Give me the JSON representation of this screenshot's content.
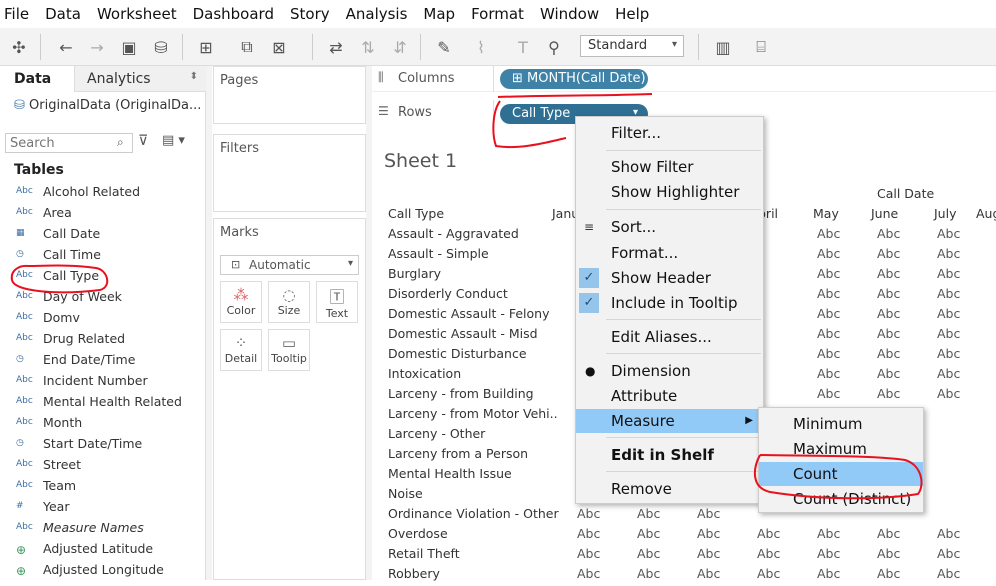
{
  "menubar": [
    "File",
    "Data",
    "Worksheet",
    "Dashboard",
    "Story",
    "Analysis",
    "Map",
    "Format",
    "Window",
    "Help"
  ],
  "toolbar": {
    "mark_type": "Standard"
  },
  "left": {
    "tab_data": "Data",
    "tab_analytics": "Analytics",
    "datasource": "OriginalData (OriginalDa...",
    "search_placeholder": "Search",
    "tables_heading": "Tables",
    "fields": [
      {
        "icon": "Abc",
        "name": "Alcohol Related"
      },
      {
        "icon": "Abc",
        "name": "Area"
      },
      {
        "icon": "date",
        "name": "Call Date"
      },
      {
        "icon": "datetime",
        "name": "Call Time"
      },
      {
        "icon": "Abc",
        "name": "Call Type"
      },
      {
        "icon": "Abc",
        "name": "Day of Week"
      },
      {
        "icon": "Abc",
        "name": "Domv"
      },
      {
        "icon": "Abc",
        "name": "Drug Related"
      },
      {
        "icon": "datetime",
        "name": "End Date/Time"
      },
      {
        "icon": "Abc",
        "name": "Incident Number"
      },
      {
        "icon": "Abc",
        "name": "Mental Health Related"
      },
      {
        "icon": "Abc",
        "name": "Month"
      },
      {
        "icon": "datetime",
        "name": "Start Date/Time"
      },
      {
        "icon": "Abc",
        "name": "Street"
      },
      {
        "icon": "Abc",
        "name": "Team"
      },
      {
        "icon": "#",
        "name": "Year"
      },
      {
        "icon": "Abc",
        "name": "Measure Names"
      },
      {
        "icon": "globe",
        "name": "Adjusted Latitude"
      },
      {
        "icon": "globe",
        "name": "Adjusted Longitude"
      }
    ]
  },
  "cards": {
    "pages": "Pages",
    "filters": "Filters",
    "marks": "Marks",
    "marks_type": "Automatic",
    "buttons": [
      "Color",
      "Size",
      "Text",
      "Detail",
      "Tooltip"
    ]
  },
  "shelves": {
    "columns_label": "Columns",
    "rows_label": "Rows",
    "columns_pill": "MONTH(Call Date)",
    "rows_pill": "Call Type"
  },
  "sheet": {
    "title": "Sheet 1",
    "header_field": "Call Type",
    "column_header": "Call Date",
    "cell": "Abc",
    "months": [
      "Janu",
      "pril",
      "May",
      "June",
      "July",
      "Aug"
    ],
    "rows": [
      "Assault - Aggravated",
      "Assault - Simple",
      "Burglary",
      "Disorderly Conduct",
      "Domestic Assault - Felony",
      "Domestic Assault - Misd",
      "Domestic Disturbance",
      "Intoxication",
      "Larceny - from Building",
      "Larceny - from Motor Vehi..",
      "Larceny - Other",
      "Larceny from a Person",
      "Mental Health Issue",
      "Noise",
      "Ordinance Violation - Other",
      "Overdose",
      "Retail Theft",
      "Robbery"
    ]
  },
  "context_menu": {
    "items": [
      "Filter...",
      "Show Filter",
      "Show Highlighter",
      "Sort...",
      "Format...",
      "Show Header",
      "Include in Tooltip",
      "Edit Aliases...",
      "Dimension",
      "Attribute",
      "Measure",
      "Edit in Shelf",
      "Remove"
    ]
  },
  "submenu": {
    "items": [
      "Minimum",
      "Maximum",
      "Count",
      "Count (Distinct)"
    ]
  }
}
